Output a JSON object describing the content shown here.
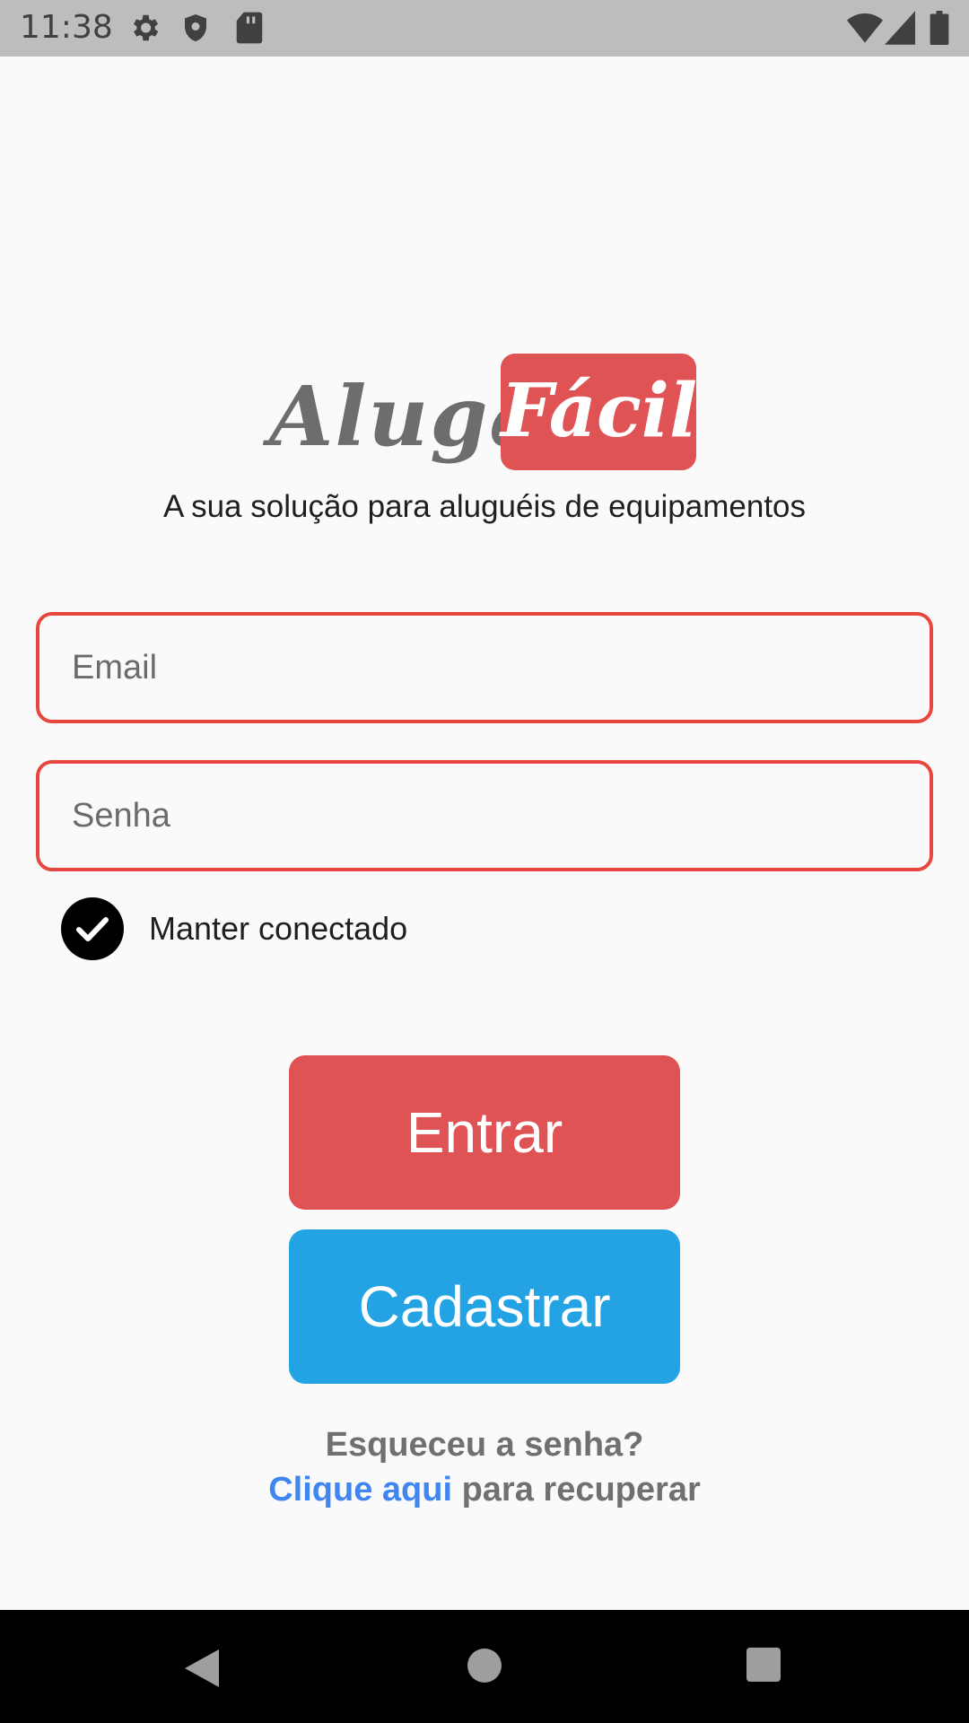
{
  "status_bar": {
    "time": "11:38",
    "icons": [
      "gear-icon",
      "shield-icon",
      "sd-card-icon",
      "wifi-icon",
      "signal-icon",
      "battery-icon"
    ]
  },
  "logo": {
    "word1": "Aluga",
    "word2": "Fácil",
    "badge_color": "#e05355"
  },
  "tagline": "A sua solução para aluguéis de equipamentos",
  "form": {
    "email_placeholder": "Email",
    "password_placeholder": "Senha",
    "remember_label": "Manter conectado",
    "remember_checked": true,
    "field_border_color": "#e8473f"
  },
  "buttons": {
    "login_label": "Entrar",
    "login_color": "#e05355",
    "register_label": "Cadastrar",
    "register_color": "#23a3e3"
  },
  "forgot": {
    "question": "Esqueceu a senha?",
    "link_text": "Clique aqui",
    "suffix": " para recuperar",
    "link_color": "#3f86f0"
  },
  "nav_bar": {
    "icons": [
      "back-icon",
      "home-icon",
      "recents-icon"
    ]
  }
}
